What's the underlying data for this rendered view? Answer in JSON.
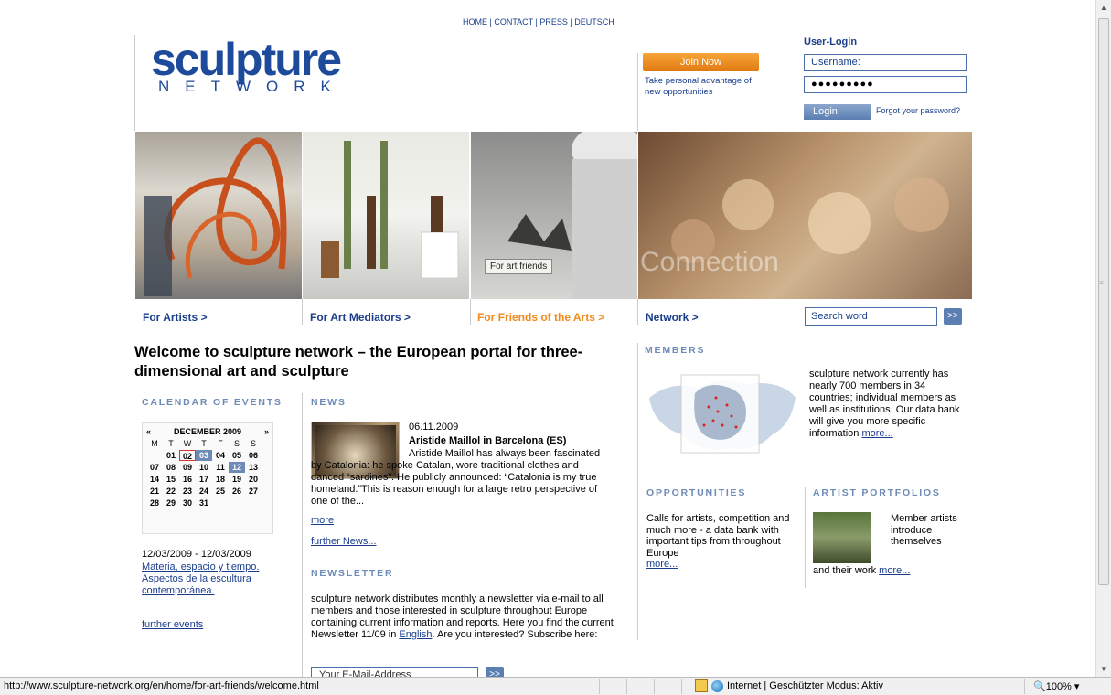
{
  "topnav": {
    "home": "HOME",
    "contact": "CONTACT",
    "press": "PRESS",
    "deutsch": "DEUTSCH",
    "separator": " | "
  },
  "logo": {
    "main": "sculpture",
    "sub": "NETWORK"
  },
  "join": {
    "button": "Join Now",
    "text": "Take personal advantage of new opportunities"
  },
  "login": {
    "title": "User-Login",
    "username_placeholder": "Username:",
    "password_value": "●●●●●●●●●",
    "button": "Login",
    "forgot": "Forgot your password?"
  },
  "hero": {
    "artists": "For Artists >",
    "mediators": "For Art Mediators >",
    "friends": "For Friends of the Arts >",
    "network": "Network >",
    "tooltip": "For art friends",
    "network_overlay": "Connection"
  },
  "search": {
    "placeholder": "Search word",
    "go": ">>"
  },
  "headline": "Welcome to sculpture network – the European portal for three-dimensional art and sculpture",
  "calendar": {
    "heading": "CALENDAR OF EVENTS",
    "prev": "«",
    "next": "»",
    "month": "DECEMBER 2009",
    "dow": [
      "M",
      "T",
      "W",
      "T",
      "F",
      "S",
      "S"
    ],
    "weeks": [
      [
        "",
        "01",
        "02",
        "03",
        "04",
        "05",
        "06"
      ],
      [
        "07",
        "08",
        "09",
        "10",
        "11",
        "12",
        "13"
      ],
      [
        "14",
        "15",
        "16",
        "17",
        "18",
        "19",
        "20"
      ],
      [
        "21",
        "22",
        "23",
        "24",
        "25",
        "26",
        "27"
      ],
      [
        "28",
        "29",
        "30",
        "31",
        "",
        "",
        ""
      ]
    ],
    "today": "02",
    "selected": [
      "03",
      "12"
    ],
    "event_date": "12/03/2009 - 12/03/2009",
    "event_link": "Materia, espacio y tiempo. Aspectos de la escultura contemporánea.",
    "further": "further events"
  },
  "news": {
    "heading": "NEWS",
    "date": "06.11.2009",
    "title": "Aristide Maillol in Barcelona (ES)",
    "body": "Aristide Maillol has always been fascinated by Catalonia: he spoke Catalan, wore traditional clothes and danced “sardines”. He publicly announced: “Catalonia is my true homeland.”This is reason enough for a large retro perspective of one of the...",
    "more": "more",
    "further": "further News..."
  },
  "newsletter": {
    "heading": "NEWSLETTER",
    "body_1": "sculpture network distributes monthly a newsletter via e-mail to all members and those interested in sculpture throughout Europe containing current information and reports. Here you find the current Newsletter 11/09 in ",
    "link": "English",
    "body_2": ". Are you interested? Subscribe here:",
    "email_placeholder": "Your E-Mail-Address",
    "go": ">>"
  },
  "members": {
    "heading": "MEMBERS",
    "text": "sculpture network currently has nearly 700 members in 34 countries; individual members as well as institutions. Our data bank will give you more specific information ",
    "more": "more..."
  },
  "opportunities": {
    "heading": "OPPORTUNITIES",
    "text": "Calls for artists, competition and much more - a data bank with important tips from throughout Europe",
    "more": "more..."
  },
  "portfolios": {
    "heading": "ARTIST PORTFOLIOS",
    "text": "Member artists introduce themselves",
    "text2": "and their work ",
    "more": "more..."
  },
  "statusbar": {
    "url": "http://www.sculpture-network.org/en/home/for-art-friends/welcome.html",
    "zone": "Internet | Geschützter Modus: Aktiv",
    "zoom": "100%"
  },
  "colors": {
    "brand_blue": "#1d4a9a",
    "link": "#1a3e8c",
    "orange": "#f08a1c",
    "heading": "#6d8bb6"
  }
}
